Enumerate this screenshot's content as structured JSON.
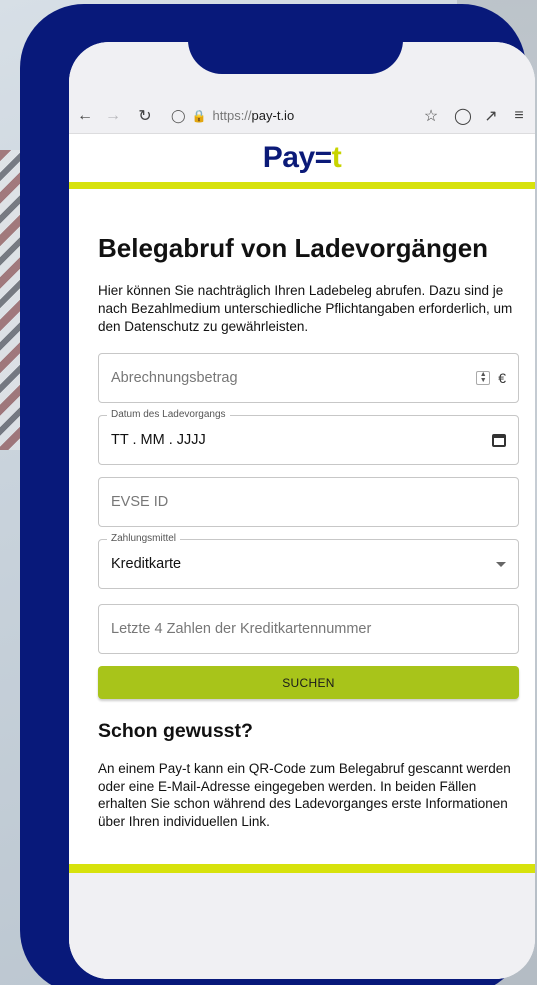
{
  "browser": {
    "url_scheme": "https://",
    "url_host": "pay-t.io"
  },
  "brand": {
    "logo_prefix": "Pay",
    "logo_eq": "=",
    "logo_suffix": "t"
  },
  "page": {
    "title": "Belegabruf von Ladevorgängen",
    "intro": "Hier können Sie nachträglich Ihren Ladebeleg abrufen. Dazu sind je nach Bezahlmedium unterschiedliche Pflichtangaben erforderlich, um den Datenschutz zu gewährleisten."
  },
  "form": {
    "amount_placeholder": "Abrechnungsbetrag",
    "currency": "€",
    "date_label": "Datum des Ladevorgangs",
    "date_value": "TT . MM . JJJJ",
    "evse_placeholder": "EVSE ID",
    "payment_label": "Zahlungsmittel",
    "payment_value": "Kreditkarte",
    "card_placeholder": "Letzte 4 Zahlen der Kreditkartennummer",
    "search_label": "SUCHEN"
  },
  "info": {
    "title": "Schon gewusst?",
    "text": "An einem Pay-t kann ein QR-Code zum Belegabruf gescannt werden oder eine E-Mail-Adresse eingegeben werden. In beiden Fällen erhalten Sie schon während des Ladevorganges erste Informationen über Ihren individuellen Link."
  },
  "icons": [
    "back-arrow-icon",
    "forward-arrow-icon",
    "reload-icon",
    "shield-icon",
    "lock-icon",
    "star-icon",
    "pocket-icon",
    "share-icon",
    "menu-icon",
    "calendar-icon",
    "dropdown-caret-icon"
  ],
  "colors": {
    "phone_frame": "#08197a",
    "accent": "#d7e20c",
    "button": "#a8c41a",
    "logo": "#0b1a78"
  }
}
